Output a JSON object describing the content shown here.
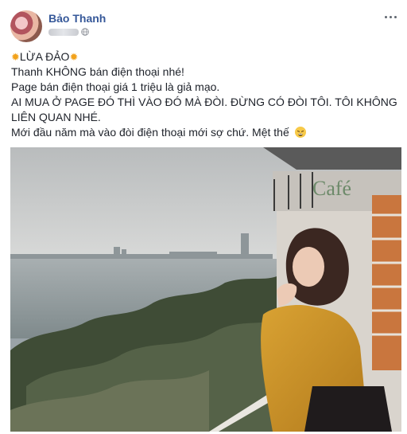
{
  "post": {
    "author": "Bảo Thanh",
    "lines": [
      "LỪA ĐẢO",
      "Thanh KHÔNG bán điện thoại nhé!",
      "Page bán điện thoại giá 1 triệu là giả mạo.",
      "AI MUA Ở PAGE ĐÓ THÌ VÀO ĐÓ MÀ ĐÒI. ĐỪNG CÓ ĐÒI TÔI. TÔI KHÔNG LIÊN QUAN NHÉ.",
      "Mới đầu năm mà vào đòi điện thoại mới sợ chứ. Mệt thế"
    ],
    "photo_sign": "Café",
    "icons": {
      "privacy": "globe-icon",
      "more": "more-options-icon",
      "emoji_start": "sparkle-emoji",
      "emoji_end": "tired-face-emoji"
    }
  }
}
